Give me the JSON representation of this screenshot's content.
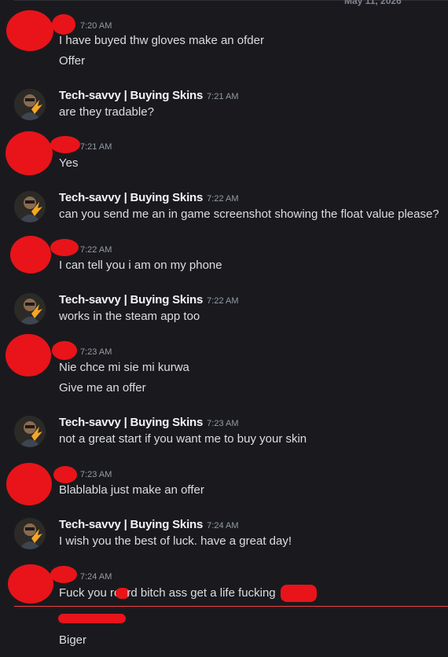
{
  "top_date": "May 11, 2026",
  "bot_username": "Tech-savvy | Buying Skins",
  "colors": {
    "background": "#1a1a1e",
    "redaction": "#e8141a",
    "new_messages_divider": "#f23f42",
    "avatar_accent": "#f5a623"
  },
  "messages": [
    {
      "time": "7:20 AM",
      "lines": [
        "I have buyed thw gloves make an ofder",
        "Offer"
      ]
    },
    {
      "time": "7:21 AM",
      "lines": [
        "are they tradable?"
      ]
    },
    {
      "time": "7:21 AM",
      "lines": [
        "Yes"
      ]
    },
    {
      "time": "7:22 AM",
      "lines": [
        "can you send me an in game screenshot showing the float value please?"
      ]
    },
    {
      "time": "7:22 AM",
      "lines": [
        "I can tell you i am on my phone"
      ]
    },
    {
      "time": "7:22 AM",
      "lines": [
        "works in the steam app too"
      ]
    },
    {
      "time": "7:23 AM",
      "lines": [
        "Nie chce mi sie mi kurwa",
        "Give me an offer"
      ]
    },
    {
      "time": "7:23 AM",
      "lines": [
        "not a great start if you want me to buy your skin"
      ]
    },
    {
      "time": "7:23 AM",
      "lines": [
        "Blablabla just make an offer"
      ]
    },
    {
      "time": "7:24 AM",
      "lines": [
        "I wish you the best of luck. have a great day!"
      ]
    },
    {
      "time": "7:24 AM",
      "line_parts": [
        "Fuck you re",
        "rd bitch ass get a life fucking"
      ]
    },
    {
      "lines": [
        "Biger"
      ]
    }
  ]
}
